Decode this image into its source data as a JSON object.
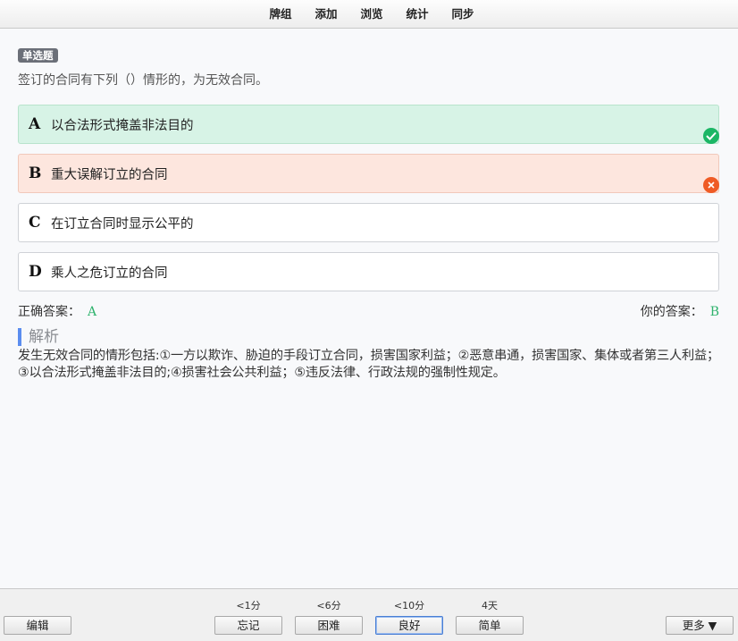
{
  "toolbar": {
    "items": [
      "牌组",
      "添加",
      "浏览",
      "统计",
      "同步"
    ]
  },
  "card": {
    "type_badge": "单选题",
    "question": "签订的合同有下列（）情形的，为无效合同。",
    "options": [
      {
        "letter": "A",
        "text": "以合法形式掩盖非法目的",
        "state": "correct"
      },
      {
        "letter": "B",
        "text": "重大误解订立的合同",
        "state": "wrong"
      },
      {
        "letter": "C",
        "text": "在订立合同时显示公平的",
        "state": "normal"
      },
      {
        "letter": "D",
        "text": "乘人之危订立的合同",
        "state": "normal"
      }
    ],
    "correct_label": "正确答案：",
    "correct_value": "A",
    "your_label": "你的答案：",
    "your_value": "B",
    "analysis_title": "解析",
    "analysis_text": "发生无效合同的情形包括:①一方以欺诈、胁迫的手段订立合同，损害国家利益；②恶意串通，损害国家、集体或者第三人利益；③以合法形式掩盖非法目的;④损害社会公共利益；⑤违反法律、行政法规的强制性规定。"
  },
  "bottom": {
    "edit_label": "编辑",
    "more_label": "更多 ▼",
    "intervals": [
      "<1分",
      "<6分",
      "<10分",
      "4天"
    ],
    "answers": [
      "忘记",
      "困难",
      "良好",
      "简单"
    ]
  },
  "colors": {
    "correct": "#1bb665",
    "wrong": "#ef5b25",
    "accent": "#5b8def"
  },
  "icons": {
    "correct_mark": "check-circle-icon",
    "wrong_mark": "x-circle-icon"
  }
}
